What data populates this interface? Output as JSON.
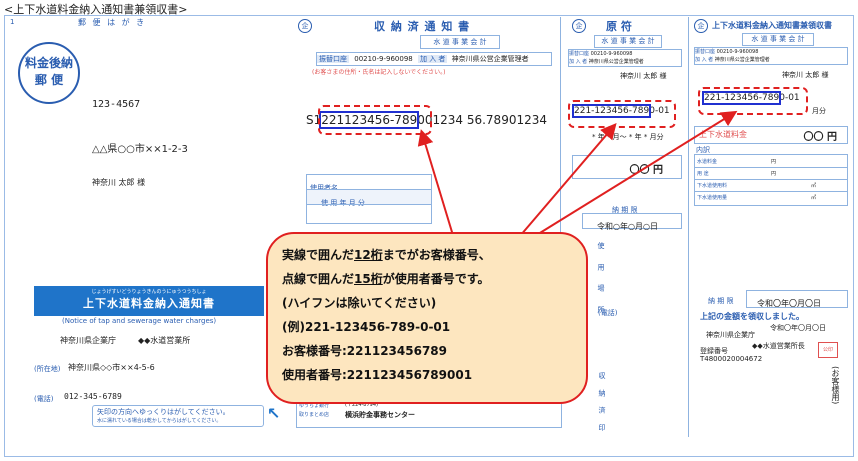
{
  "page_title": "<上下水道料金納入通知書兼領収書>",
  "postcard": {
    "header": "郵 便 は が き",
    "stamp_line1": "料金後納",
    "stamp_line2": "郵 便",
    "postal_code": "123-4567",
    "address": "△△県○○市××1-2-3",
    "recipient": "神奈川 太郎 様",
    "notice_kana": "じょうげすいどうりょうきんのうにゅうつうちしょ",
    "notice_title": "上下水道料金納入通知書",
    "notice_english": "(Notice of tap and sewerage water charges)",
    "sender_org": "神奈川県企業庁",
    "sender_office": "◆◆水道営業所",
    "address_label": "(所在地)",
    "sender_address": "神奈川県◇◇市××4-5-6",
    "phone_label": "(電話)",
    "phone": "012-345-6789",
    "peel_line1": "矢印の方向へゆっくりはがしてください。",
    "peel_line2": "水に濡れている場合は乾かしてからはがしてください。",
    "page_number": "1"
  },
  "receipt_section": {
    "title": "収 納 済 通 知 書",
    "subtitle": "水 道 事 業 会 計",
    "transfer_label": "振替口座",
    "account_number": "00210-9-960098",
    "member_label": "加 入 者",
    "member_name": "神奈川県公営企業管理者",
    "red_note": "(お客さまの住所・氏名は記入しないでください。)",
    "barcode_text": "S1221123456789001234 56.78901234",
    "barcode_boxed": "221123456-789",
    "barcode_prefix": "S1",
    "barcode_rest": "001234 56.78901234",
    "user_name_label": "使用者名",
    "period_label": "使 用 年 月 分"
  },
  "original_section": {
    "title": "原 符",
    "subtitle": "水 道 事 業 会 計",
    "transfer_label": "振替口座",
    "account_number": "00210-9-960098",
    "member_label": "加 入 者",
    "member_name": "神奈川県公営企業管理者",
    "recipient": "神奈川 太郎 様",
    "customer_number": "221-123456-789",
    "customer_number_suffix": "0-01",
    "period": "* 年 * 月～ * 年 * 月分",
    "amount": "〇〇 円",
    "due_label": "納 期 限",
    "due_date": "令和○年○月○日",
    "usage_label": "使 用 場 所"
  },
  "stub_section": {
    "title": "上下水道料金納入通知書兼領収書",
    "subtitle": "水 道 事 業 会 計",
    "transfer_label": "振替口座",
    "account_number": "00210-9-960098",
    "member_label": "加 入 者",
    "member_name": "神奈川県公営企業管理者",
    "recipient": "神奈川 太郎 様",
    "customer_number": "221-123456-789",
    "customer_number_suffix": "0-01",
    "period_suffix": "月分",
    "fee_label": "上下水道料金",
    "fee_amount": "〇〇 円",
    "breakdown_label": "内訳",
    "rows": [
      {
        "label": "水道料金",
        "unit": "円"
      },
      {
        "label": "用 途",
        "unit": "円"
      },
      {
        "label": "下水道使用料",
        "unit": "㎥"
      },
      {
        "label": "下水道使用量",
        "unit": "㎥"
      }
    ],
    "due_label": "納 期 限",
    "due_date": "令和〇年〇月〇日",
    "received_text": "上記の金額を領収しました。",
    "receipt_date": "令和〇年〇月〇日",
    "receiver_org": "神奈川県企業庁",
    "receiver_office": "◆◆水道営業所長",
    "reg_label": "登録番号",
    "reg_number": "T4800020004672",
    "seal_text": "公印",
    "customer_copy": "(お客様用)"
  },
  "bottom_strip": {
    "bank_line1": "ゆうちょ銀行",
    "bank_line2": "取りまとめ店",
    "center_postal": "(〒224-8794)",
    "center_name": "横浜貯金事務センター",
    "stamp_label": "収 納 済 印",
    "phone_label": "(電話)"
  },
  "callout": {
    "line1_a": "実線で囲んだ",
    "line1_b": "12桁",
    "line1_c": "までがお客様番号、",
    "line2_a": "点線で囲んだ",
    "line2_b": "15桁",
    "line2_c": "が使用者番号です。",
    "line3": "(ハイフンは除いてください)",
    "line4": "(例)221-123456-789-0-01",
    "line5": "お客様番号:221123456789",
    "line6": "使用者番号:221123456789001"
  },
  "colors": {
    "callout_fill": "#fde6bf",
    "callout_border": "#e02020",
    "solid_box": "#2030d0",
    "form_blue": "#2a5db0",
    "notice_banner": "#1f74c9"
  }
}
